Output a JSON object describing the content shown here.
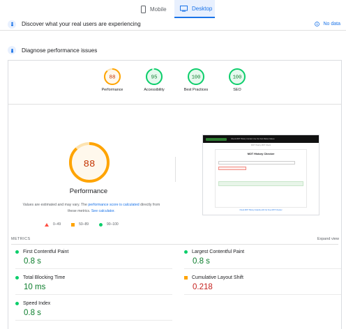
{
  "tabs": {
    "mobile": "Mobile",
    "desktop": "Desktop",
    "active": "desktop"
  },
  "discover": {
    "title": "Discover what your real users are experiencing",
    "nodata": "No data"
  },
  "diagnose": {
    "title": "Diagnose performance issues"
  },
  "scores": [
    {
      "label": "Performance",
      "value": "88",
      "status": "average"
    },
    {
      "label": "Accessibility",
      "value": "95",
      "status": "pass"
    },
    {
      "label": "Best Practices",
      "value": "100",
      "status": "pass"
    },
    {
      "label": "SEO",
      "value": "100",
      "status": "pass"
    }
  ],
  "performance": {
    "value": "88",
    "title": "Performance",
    "note_prefix": "Values are estimated and may vary. The ",
    "note_link1": "performance score is calculated",
    "note_mid": " directly from these metrics. ",
    "note_link2": "See calculator."
  },
  "legend": {
    "fail": "0–49",
    "average": "50–89",
    "pass": "90–100"
  },
  "thumbnail": {
    "heading": "MOT History Checker",
    "bar_text": "Check MOT History  Contact  Use Our Fair Market Values",
    "subtitle": "MOT History  MOT Check",
    "footer": "Check MOT History Instantly with Our Free MOT Checker"
  },
  "metrics": {
    "header": "METRICS",
    "expand": "Expand view",
    "fcp": {
      "name": "First Contentful Paint",
      "value": "0.8 s"
    },
    "lcp": {
      "name": "Largest Contentful Paint",
      "value": "0.8 s"
    },
    "tbt": {
      "name": "Total Blocking Time",
      "value": "10 ms"
    },
    "cls": {
      "name": "Cumulative Layout Shift",
      "value": "0.218"
    },
    "si": {
      "name": "Speed Index",
      "value": "0.8 s"
    }
  },
  "colors": {
    "pass": "#0cce6b",
    "average": "#ffa400",
    "fail": "#ff4e42",
    "accent": "#1a73e8"
  }
}
